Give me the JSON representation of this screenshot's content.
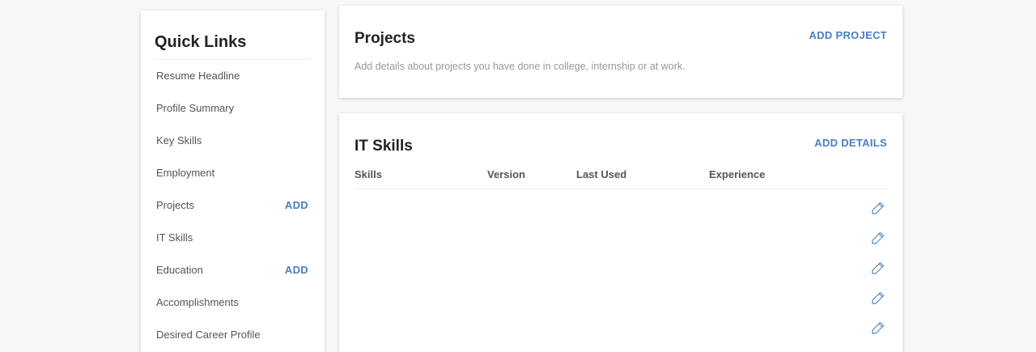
{
  "quick_links": {
    "title": "Quick Links",
    "items": [
      {
        "label": "Resume Headline",
        "action": ""
      },
      {
        "label": "Profile Summary",
        "action": ""
      },
      {
        "label": "Key Skills",
        "action": ""
      },
      {
        "label": "Employment",
        "action": ""
      },
      {
        "label": "Projects",
        "action": "ADD"
      },
      {
        "label": "IT Skills",
        "action": ""
      },
      {
        "label": "Education",
        "action": "ADD"
      },
      {
        "label": "Accomplishments",
        "action": ""
      },
      {
        "label": "Desired Career Profile",
        "action": ""
      }
    ]
  },
  "projects": {
    "title": "Projects",
    "action": "ADD PROJECT",
    "description": "Add details about projects you have done in college, internship or at work."
  },
  "it_skills": {
    "title": "IT Skills",
    "action": "ADD DETAILS",
    "columns": {
      "skills": "Skills",
      "version": "Version",
      "last_used": "Last Used",
      "experience": "Experience"
    },
    "edit_rows": 5
  },
  "icons": {
    "edit": "pencil-icon"
  },
  "colors": {
    "accent": "#4a7ec1",
    "background": "#f7f7f7",
    "muted_text": "#999999"
  }
}
